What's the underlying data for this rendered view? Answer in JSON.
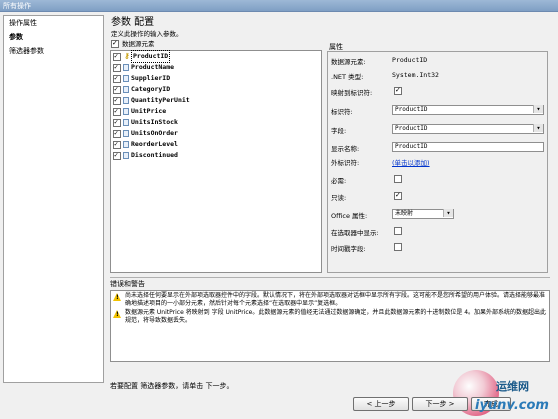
{
  "title": "所有操作",
  "nav": {
    "items": [
      {
        "label": "操作属性",
        "bold": false
      },
      {
        "label": "参数",
        "bold": true
      },
      {
        "label": "筛选器参数",
        "bold": false
      }
    ]
  },
  "main": {
    "heading": "参数 配置",
    "subheading": "定义此操作的输入参数。",
    "source_label": "数据源元素",
    "fields": [
      {
        "name": "ProductID",
        "key": true,
        "selected": true
      },
      {
        "name": "ProductName",
        "key": false,
        "selected": false
      },
      {
        "name": "SupplierID",
        "key": false,
        "selected": false
      },
      {
        "name": "CategoryID",
        "key": false,
        "selected": false
      },
      {
        "name": "QuantityPerUnit",
        "key": false,
        "selected": false
      },
      {
        "name": "UnitPrice",
        "key": false,
        "selected": false
      },
      {
        "name": "UnitsInStock",
        "key": false,
        "selected": false
      },
      {
        "name": "UnitsOnOrder",
        "key": false,
        "selected": false
      },
      {
        "name": "ReorderLevel",
        "key": false,
        "selected": false
      },
      {
        "name": "Discontinued",
        "key": false,
        "selected": false
      }
    ]
  },
  "props": {
    "title": "属性",
    "element_label": "数据源元素:",
    "element_value": "ProductID",
    "net_type_label": ".NET 类型:",
    "net_type_value": "System.Int32",
    "map_label": "映射到标识符:",
    "identifier_label": "标识符:",
    "identifier_value": "ProductID",
    "field_label": "字段:",
    "field_value": "ProductID",
    "display_label": "显示名称:",
    "display_value": "ProductID",
    "foreign_label": "外标识符:",
    "foreign_link": "(单击以添加)",
    "required_label": "必需:",
    "readonly_label": "只读:",
    "office_label": "Office 属性:",
    "office_value": "未映射",
    "picker_label": "在选取器中显示:",
    "timestamp_label": "时间戳字段:"
  },
  "warnings": {
    "title": "错误和警告",
    "items": [
      "尚未选择任何要显示在外部项选取器控件中的字段。默认情况下，将在外部项选取器对话框中显示所有字段。这可能不是您所希望的用户体验。请选择能够最准确地描述项目的一小部分元素，然后针对每个元素选择“在选取器中显示”复选框。",
      "数据源元素 UnitPrice 将映射到 字段 UnitPrice。此数据源元素的值经无法通过数据源确定，并且此数据源元素的十进制数位是 4。加果外部系统的数据超出此规范，将导致数据丢失。"
    ]
  },
  "footer": {
    "hint": "若要配置 筛选器参数，请单击 下一步。",
    "back": "< 上一步",
    "next": "下一步 >",
    "finish": "完成"
  },
  "watermark": {
    "cn": "运维网",
    "en": "iyunv.com"
  },
  "colors": {
    "titlebar": "#7f9fc4",
    "link": "#0033cc",
    "warning": "#f2c200"
  }
}
